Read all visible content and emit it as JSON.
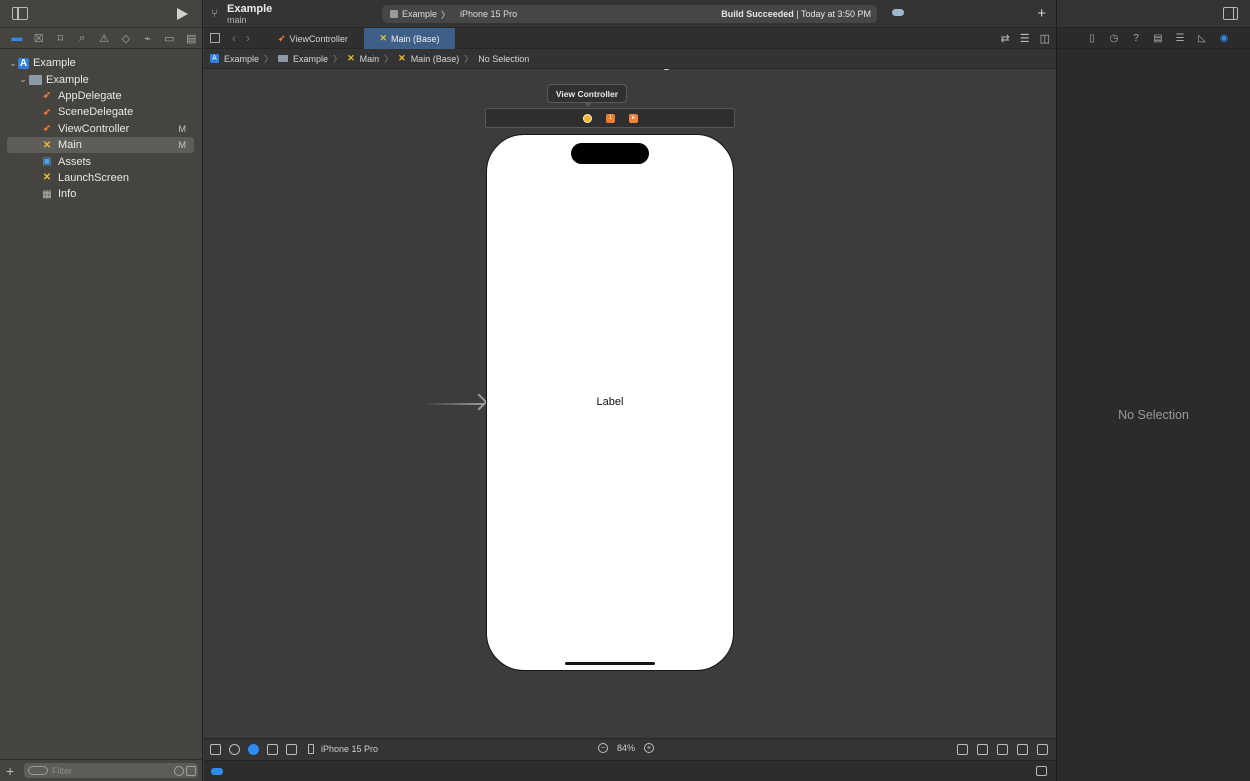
{
  "navigator": {
    "tree": [
      {
        "label": "Example",
        "icon": "project-icon",
        "level": 0,
        "expanded": true
      },
      {
        "label": "Example",
        "icon": "folder-icon",
        "level": 1,
        "expanded": true
      },
      {
        "label": "AppDelegate",
        "icon": "swift-file-icon",
        "level": 2,
        "badge": ""
      },
      {
        "label": "SceneDelegate",
        "icon": "swift-file-icon",
        "level": 2,
        "badge": ""
      },
      {
        "label": "ViewController",
        "icon": "swift-file-icon",
        "level": 2,
        "badge": "M"
      },
      {
        "label": "Main",
        "icon": "storyboard-icon",
        "level": 2,
        "badge": "M",
        "selected": true
      },
      {
        "label": "Assets",
        "icon": "asset-catalog-icon",
        "level": 2,
        "badge": ""
      },
      {
        "label": "LaunchScreen",
        "icon": "storyboard-icon",
        "level": 2,
        "badge": ""
      },
      {
        "label": "Info",
        "icon": "plist-icon",
        "level": 2,
        "badge": ""
      }
    ],
    "filter_placeholder": "Filter"
  },
  "toolbar": {
    "project": "Example",
    "branch": "main",
    "scheme": "Example",
    "scheme_sep": "〉",
    "device": "iPhone 15 Pro",
    "status_bold": "Build Succeeded",
    "status_rest": " | Today at 3:50 PM"
  },
  "tabs": [
    {
      "label": "ViewController",
      "icon": "swift-file-icon",
      "active": false
    },
    {
      "label": "Main (Base)",
      "icon": "storyboard-icon",
      "active": true
    }
  ],
  "breadcrumb": [
    "Example",
    "Example",
    "Main",
    "Main (Base)",
    "No Selection"
  ],
  "canvas": {
    "scene_title": "View Controller",
    "label_text": "Label",
    "scene_badge_2": "1",
    "scene_badge_3": "▸"
  },
  "canvas_bottom": {
    "device": "iPhone 15 Pro",
    "zoom": "84%"
  },
  "inspector": {
    "empty_text": "No Selection"
  },
  "colors": {
    "accent": "#2d8cf0",
    "swift": "#f0773b",
    "storyboard": "#e9c12c",
    "tab_active": "#3e5f88"
  }
}
